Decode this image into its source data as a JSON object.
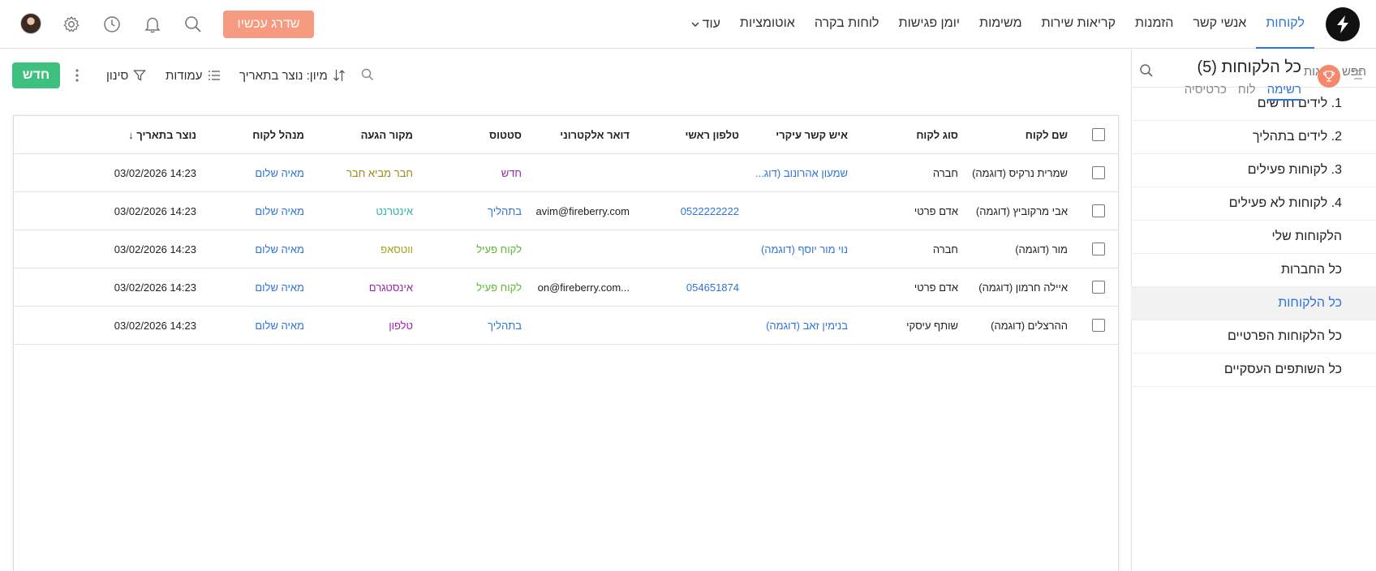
{
  "nav": {
    "items": [
      "לקוחות",
      "אנשי קשר",
      "הזמנות",
      "קריאות שירות",
      "משימות",
      "יומן פגישות",
      "לוחות בקרה",
      "אוטומציות"
    ],
    "more_label": "עוד",
    "upgrade_label": "שדרג עכשיו"
  },
  "header": {
    "title": "כל הלקוחות (5)",
    "tabs": [
      "רשימה",
      "לוח",
      "כרטיסיה"
    ]
  },
  "toolbar": {
    "new_label": "חדש",
    "filter_label": "סינון",
    "columns_label": "עמודות",
    "sort_label": "מיון: נוצר בתאריך"
  },
  "sidebar": {
    "search_placeholder": "חפש תצוגות",
    "views": [
      "1. לידים חדשים",
      "2. לידים בתהליך",
      "3. לקוחות פעילים",
      "4. לקוחות לא פעילים",
      "הלקוחות שלי",
      "כל החברות",
      "כל הלקוחות",
      "כל הלקוחות הפרטיים",
      "כל השותפים העסקיים"
    ],
    "active_view": "כל הלקוחות"
  },
  "table": {
    "columns": {
      "name": "שם לקוח",
      "type": "סוג לקוח",
      "contact": "איש קשר עיקרי",
      "phone": "טלפון ראשי",
      "email": "דואר אלקטרוני",
      "status": "סטטוס",
      "source": "מקור הגעה",
      "manager": "מנהל לקוח",
      "created": "נוצר בתאריך ↓"
    },
    "rows": [
      {
        "name": "שמרית נרקיס (דוגמה)",
        "type": "חברה",
        "contact": "שמעון אהרונוב (דוג...",
        "phone": "",
        "email": "",
        "status": "חדש",
        "status_color": "#9b27b0",
        "source": "חבר מביא חבר",
        "source_color": "#9a8a18",
        "manager": "מאיה שלום",
        "created": "03/02/2026 14:23"
      },
      {
        "name": "אבי מרקוביץ (דוגמה)",
        "type": "אדם פרטי",
        "contact": "",
        "phone": "0522222222",
        "email": "avim@fireberry.com",
        "status": "בתהליך",
        "status_color": "#2f73d9",
        "source": "אינטרנט",
        "source_color": "#2bb5a8",
        "manager": "מאיה שלום",
        "created": "03/02/2026 14:23"
      },
      {
        "name": "מור (דוגמה)",
        "type": "חברה",
        "contact": "נוי מור יוסף (דוגמה)",
        "phone": "",
        "email": "",
        "status": "לקוח פעיל",
        "status_color": "#5cb82f",
        "source": "ווטסאפ",
        "source_color": "#a5a41d",
        "manager": "מאיה שלום",
        "created": "03/02/2026 14:23"
      },
      {
        "name": "איילה חרמון (דוגמה)",
        "type": "אדם פרטי",
        "contact": "",
        "phone": "054651874",
        "email": "...on@fireberry.com",
        "status": "לקוח פעיל",
        "status_color": "#5cb82f",
        "source": "אינסטגרם",
        "source_color": "#9b27b0",
        "manager": "מאיה שלום",
        "created": "03/02/2026 14:23"
      },
      {
        "name": "ההרצלים (דוגמה)",
        "type": "שותף עיסקי",
        "contact": "בנימין זאב (דוגמה)",
        "phone": "",
        "email": "",
        "status": "בתהליך",
        "status_color": "#2f73d9",
        "source": "טלפון",
        "source_color": "#9b27b0",
        "manager": "מאיה שלום",
        "created": "03/02/2026 14:23"
      }
    ]
  },
  "colors": {
    "accent": "#2f73d9",
    "upgrade": "#f69a80",
    "new_button": "#3ec17f",
    "trophy": "#f5876b"
  }
}
